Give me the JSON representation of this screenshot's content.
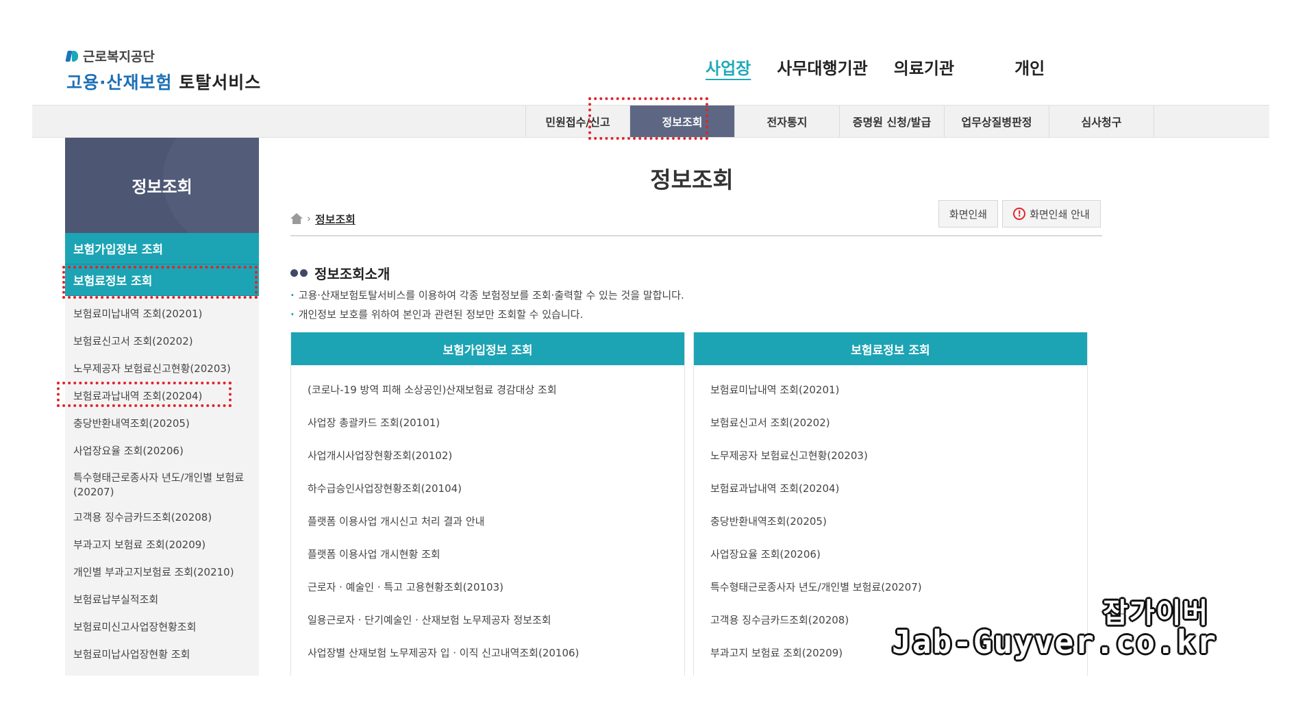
{
  "header": {
    "org_name": "근로복지공단",
    "service_name_colored": "고용·산재보험",
    "service_name_dark": "토탈서비스",
    "nav": [
      {
        "label": "사업장",
        "active": true
      },
      {
        "label": "사무대행기관"
      },
      {
        "label": "의료기관"
      },
      {
        "label": "개인"
      }
    ]
  },
  "tabs": [
    {
      "label": "민원접수/신고"
    },
    {
      "label": "정보조회",
      "active": true
    },
    {
      "label": "전자통지"
    },
    {
      "label": "증명원 신청/발급"
    },
    {
      "label": "업무상질병판정"
    },
    {
      "label": "심사청구"
    }
  ],
  "sidebar": {
    "title": "정보조회",
    "section1": "보험가입정보 조회",
    "section2": "보험료정보 조회",
    "items": [
      "보험료미납내역 조회(20201)",
      "보험료신고서 조회(20202)",
      "노무제공자 보험료신고현황(20203)",
      "보험료과납내역 조회(20204)",
      "충당반환내역조회(20205)",
      "사업장요율 조회(20206)",
      "특수형태근로종사자 년도/개인별 보험료(20207)",
      "고객용 징수금카드조회(20208)",
      "부과고지 보험료 조회(20209)",
      "개인별 부과고지보험료 조회(20210)",
      "보험료납부실적조회",
      "보험료미신고사업장현황조회",
      "보험료미납사업장현황 조회"
    ]
  },
  "content": {
    "page_title": "정보조회",
    "breadcrumb": "정보조회",
    "print_button": "화면인쇄",
    "print_guide_button": "화면인쇄 안내",
    "intro_title": "정보조회소개",
    "intro_lines": [
      "고용·산재보험토탈서비스를 이용하여 각종 보험정보를 조회·출력할 수 있는 것을 말합니다.",
      "개인정보 보호를 위하여 본인과 관련된 정보만 조회할 수 있습니다."
    ],
    "left_panel": {
      "title": "보험가입정보 조회",
      "items": [
        "(코로나-19 방역 피해 소상공인)산재보험료 경감대상 조회",
        "사업장 총괄카드 조회(20101)",
        "사업개시사업장현황조회(20102)",
        "하수급승인사업장현황조회(20104)",
        "플랫폼 이용사업 개시신고 처리 결과 안내",
        "플랫폼 이용사업 개시현황 조회",
        "근로자 · 예술인 · 특고 고용현황조회(20103)",
        "일용근로자 · 단기예술인 · 산재보험 노무제공자 정보조회",
        "사업장별 산재보험 노무제공자 입 · 이직 신고내역조회(20106)"
      ]
    },
    "right_panel": {
      "title": "보험료정보 조회",
      "items": [
        "보험료미납내역 조회(20201)",
        "보험료신고서 조회(20202)",
        "노무제공자 보험료신고현황(20203)",
        "보험료과납내역 조회(20204)",
        "충당반환내역조회(20205)",
        "사업장요율 조회(20206)",
        "특수형태근로종사자 년도/개인별 보험료(20207)",
        "고객용 징수금카드조회(20208)",
        "부과고지 보험료 조회(20209)"
      ]
    }
  },
  "watermark": {
    "line1": "잡가이버",
    "line2": "Jab-Guyver.co.kr"
  },
  "colors": {
    "accent": "#1ca4b4",
    "sidebar_header": "#4d5673",
    "active_tab": "#5d6682",
    "highlight_border": "#e0242b"
  }
}
